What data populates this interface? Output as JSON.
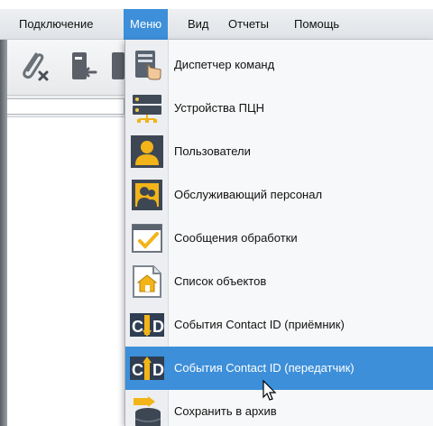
{
  "menubar": {
    "items": [
      "Подключение",
      "Меню",
      "Вид",
      "Отчеты",
      "Помощь"
    ],
    "active_index": 1
  },
  "toolbar": {
    "buttons": [
      "disconnect-icon",
      "device-icon"
    ]
  },
  "dropdown": {
    "items": [
      {
        "label": "Диспетчер команд",
        "icon": "command-dispatcher-icon"
      },
      {
        "label": "Устройства ПЦН",
        "icon": "server-devices-icon"
      },
      {
        "label": "Пользователи",
        "icon": "users-icon"
      },
      {
        "label": "Обслуживающий персонал",
        "icon": "staff-icon"
      },
      {
        "label": "Сообщения обработки",
        "icon": "processing-messages-icon"
      },
      {
        "label": "Список объектов",
        "icon": "objects-list-icon"
      },
      {
        "label": "События Contact ID (приёмник)",
        "icon": "contact-id-receiver-icon"
      },
      {
        "label": "События Contact ID (передатчик)",
        "icon": "contact-id-transmitter-icon"
      },
      {
        "label": "Сохранить в архив",
        "icon": "archive-icon"
      }
    ],
    "highlighted_index": 7,
    "icon_text": "CID"
  },
  "colors": {
    "accent": "#3d8fd9",
    "menu_bg": "#f7f8f9",
    "cid_yellow": "#f2b418",
    "cid_dark": "#2f3e52"
  }
}
